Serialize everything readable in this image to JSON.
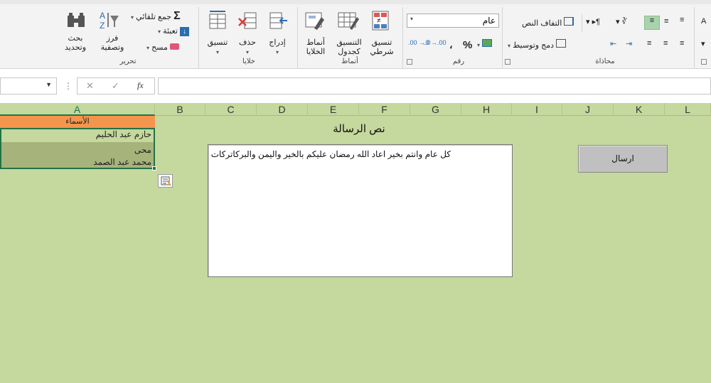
{
  "ribbon": {
    "editing": {
      "autosum_label": "جمع تلقائي",
      "fill_label": "تعبئة",
      "clear_label": "مسح",
      "sort_filter_label_1": "فرز",
      "sort_filter_label_2": "وتصفية",
      "find_select_label_1": "بحث",
      "find_select_label_2": "وتحديد",
      "group_label": "تحرير"
    },
    "cells": {
      "format_label": "تنسيق",
      "delete_label": "حذف",
      "insert_label": "إدراج",
      "group_label": "خلايا"
    },
    "styles": {
      "cell_styles_label_1": "أنماط",
      "cell_styles_label_2": "الخلايا",
      "format_table_label_1": "التنسيق",
      "format_table_label_2": "كجدول",
      "conditional_label_1": "تنسيق",
      "conditional_label_2": "شرطي",
      "group_label": "أنماط"
    },
    "number": {
      "format_value": "عام",
      "percent_symbol": "%",
      "comma_symbol": "،",
      "group_label": "رقم"
    },
    "alignment": {
      "wrap_text_label": "التفاف النص",
      "merge_center_label": "دمج وتوسيط",
      "group_label": "محاذاة"
    }
  },
  "formula_bar": {
    "fx_label": "fx",
    "cancel_symbol": "✕",
    "enter_symbol": "✓",
    "formula_value": ""
  },
  "columns": [
    "A",
    "B",
    "C",
    "D",
    "E",
    "F",
    "G",
    "H",
    "I",
    "J",
    "K",
    "L"
  ],
  "sheet": {
    "header_cell": "الأسماء",
    "names": [
      "حازم عبد الحليم",
      "محى",
      "محمد عبد الصمد"
    ]
  },
  "message": {
    "title": "نص الرسالة",
    "body": "كل عام وانتم بخير اعاد الله رمضان عليكم بالخير واليمن والبركاتركات"
  },
  "send_button": {
    "label": "ارسال"
  }
}
